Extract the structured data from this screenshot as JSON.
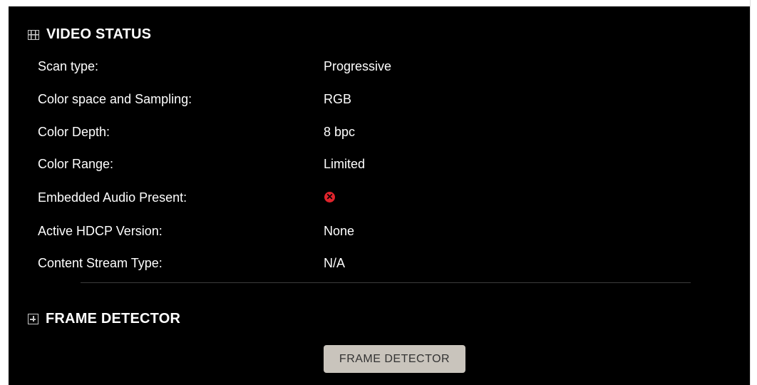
{
  "video_status": {
    "title": "VIDEO STATUS",
    "icon": "film-icon",
    "rows": [
      {
        "label": "Scan type:",
        "value": "Progressive"
      },
      {
        "label": "Color space and Sampling:",
        "value": "RGB"
      },
      {
        "label": "Color Depth:",
        "value": "8 bpc"
      },
      {
        "label": "Color Range:",
        "value": "Limited"
      },
      {
        "label": "Embedded Audio Present:",
        "value_icon": "x-circle-icon",
        "status_color": "#e0242c"
      },
      {
        "label": "Active HDCP Version:",
        "value": "None"
      },
      {
        "label": "Content Stream Type:",
        "value": "N/A"
      }
    ]
  },
  "frame_detector": {
    "title": "FRAME DETECTOR",
    "icon": "plus-box-icon",
    "button_label": "FRAME DETECTOR"
  },
  "colors": {
    "background": "#000000",
    "text": "#ffffff",
    "button_bg": "#c9c4bc",
    "error": "#e0242c"
  }
}
